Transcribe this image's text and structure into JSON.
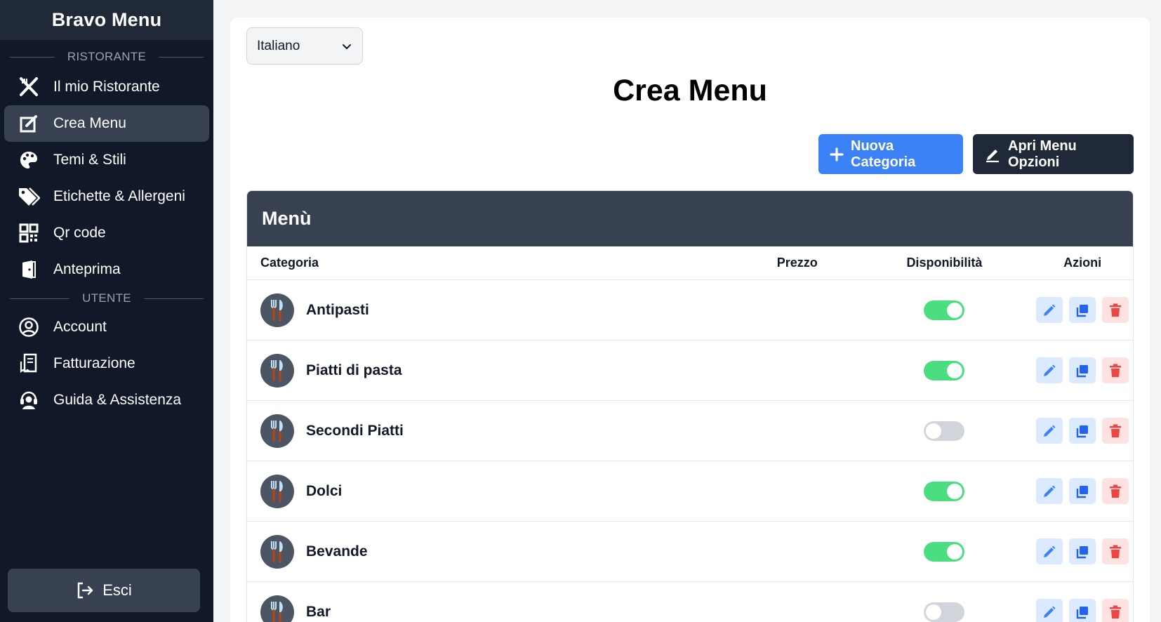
{
  "app": {
    "brand": "Bravo Menu"
  },
  "sidebar": {
    "section_restaurant": "RISTORANTE",
    "section_user": "UTENTE",
    "items": [
      {
        "label": "Il mio Ristorante",
        "icon": "utensils-cross-icon"
      },
      {
        "label": "Crea Menu",
        "icon": "edit-square-icon",
        "active": true
      },
      {
        "label": "Temi & Stili",
        "icon": "palette-icon"
      },
      {
        "label": "Etichette & Allergeni",
        "icon": "tags-icon"
      },
      {
        "label": "Qr code",
        "icon": "qr-code-icon"
      },
      {
        "label": "Anteprima",
        "icon": "preview-door-icon"
      }
    ],
    "user_items": [
      {
        "label": "Account",
        "icon": "user-circle-icon"
      },
      {
        "label": "Fatturazione",
        "icon": "receipt-icon"
      },
      {
        "label": "Guida & Assistenza",
        "icon": "headset-icon"
      }
    ],
    "logout_label": "Esci"
  },
  "main": {
    "language": "Italiano",
    "title": "Crea Menu",
    "new_category_label": "Nuova Categoria",
    "open_options_label": "Apri Menu Opzioni"
  },
  "table": {
    "title": "Menù",
    "columns": {
      "category": "Categoria",
      "price": "Prezzo",
      "availability": "Disponibilità",
      "actions": "Azioni"
    },
    "rows": [
      {
        "name": "Antipasti",
        "price": "",
        "available": true
      },
      {
        "name": "Piatti di pasta",
        "price": "",
        "available": true
      },
      {
        "name": "Secondi Piatti",
        "price": "",
        "available": false
      },
      {
        "name": "Dolci",
        "price": "",
        "available": true
      },
      {
        "name": "Bevande",
        "price": "",
        "available": true
      },
      {
        "name": "Bar",
        "price": "",
        "available": false
      }
    ]
  },
  "colors": {
    "primary": "#3b82f6",
    "sidebar": "#111827",
    "toggle_on": "#4ade80",
    "danger": "#ef4444"
  }
}
